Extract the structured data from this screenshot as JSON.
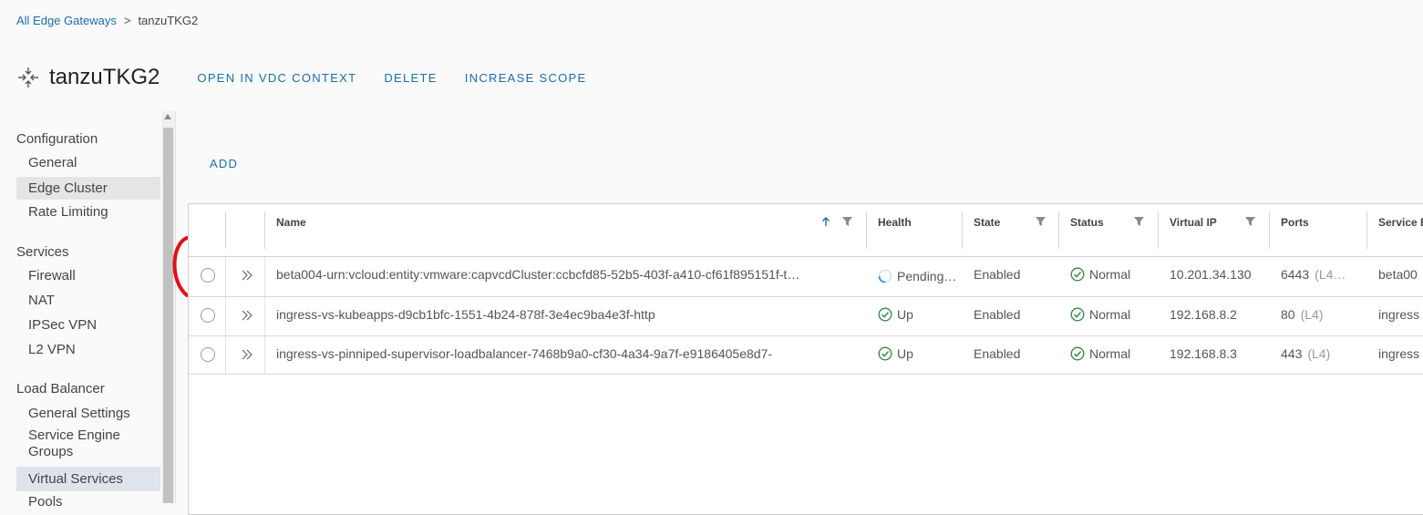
{
  "breadcrumb": {
    "parent": "All Edge Gateways",
    "separator": ">",
    "current": "tanzuTKG2"
  },
  "header": {
    "title": "tanzuTKG2",
    "actions": [
      "OPEN IN VDC CONTEXT",
      "DELETE",
      "INCREASE SCOPE"
    ]
  },
  "sidebar": {
    "sections": [
      {
        "title": "Configuration",
        "items": [
          "General",
          "Edge Cluster",
          "Rate Limiting"
        ]
      },
      {
        "title": "Services",
        "items": [
          "Firewall",
          "NAT",
          "IPSec VPN",
          "L2 VPN"
        ]
      },
      {
        "title": "Load Balancer",
        "items": [
          "General Settings",
          "Service Engine Groups",
          "Virtual Services",
          "Pools"
        ]
      }
    ],
    "active_item": "Virtual Services"
  },
  "toolbar": {
    "add_label": "ADD"
  },
  "table": {
    "columns": [
      "Name",
      "Health",
      "State",
      "Status",
      "Virtual IP",
      "Ports",
      "Service E"
    ],
    "sorted_column": "Name",
    "sort_direction": "ascending",
    "rows": [
      {
        "name": "beta004-urn:vcloud:entity:vmware:capvcdCluster:ccbcfd85-52b5-403f-a410-cf61f895151f-t…",
        "health": "Pending…",
        "health_state": "pending",
        "state": "Enabled",
        "status": "Normal",
        "virtual_ip": "10.201.34.130",
        "port": "6443",
        "port_type": "(L4…",
        "service_engine": "beta00"
      },
      {
        "name": "ingress-vs-kubeapps-d9cb1bfc-1551-4b24-878f-3e4ec9ba4e3f-http",
        "health": "Up",
        "health_state": "up",
        "state": "Enabled",
        "status": "Normal",
        "virtual_ip": "192.168.8.2",
        "port": "80",
        "port_type": "(L4)",
        "service_engine": "ingress"
      },
      {
        "name": "ingress-vs-pinniped-supervisor-loadbalancer-7468b9a0-cf30-4a34-9a7f-e9186405e8d7-",
        "health": "Up",
        "health_state": "up",
        "state": "Enabled",
        "status": "Normal",
        "virtual_ip": "192.168.8.3",
        "port": "443",
        "port_type": "(L4)",
        "service_engine": "ingress"
      }
    ]
  },
  "colors": {
    "link": "#1a6ea7",
    "ok": "#2e8540",
    "annotation": "#e0101a"
  }
}
